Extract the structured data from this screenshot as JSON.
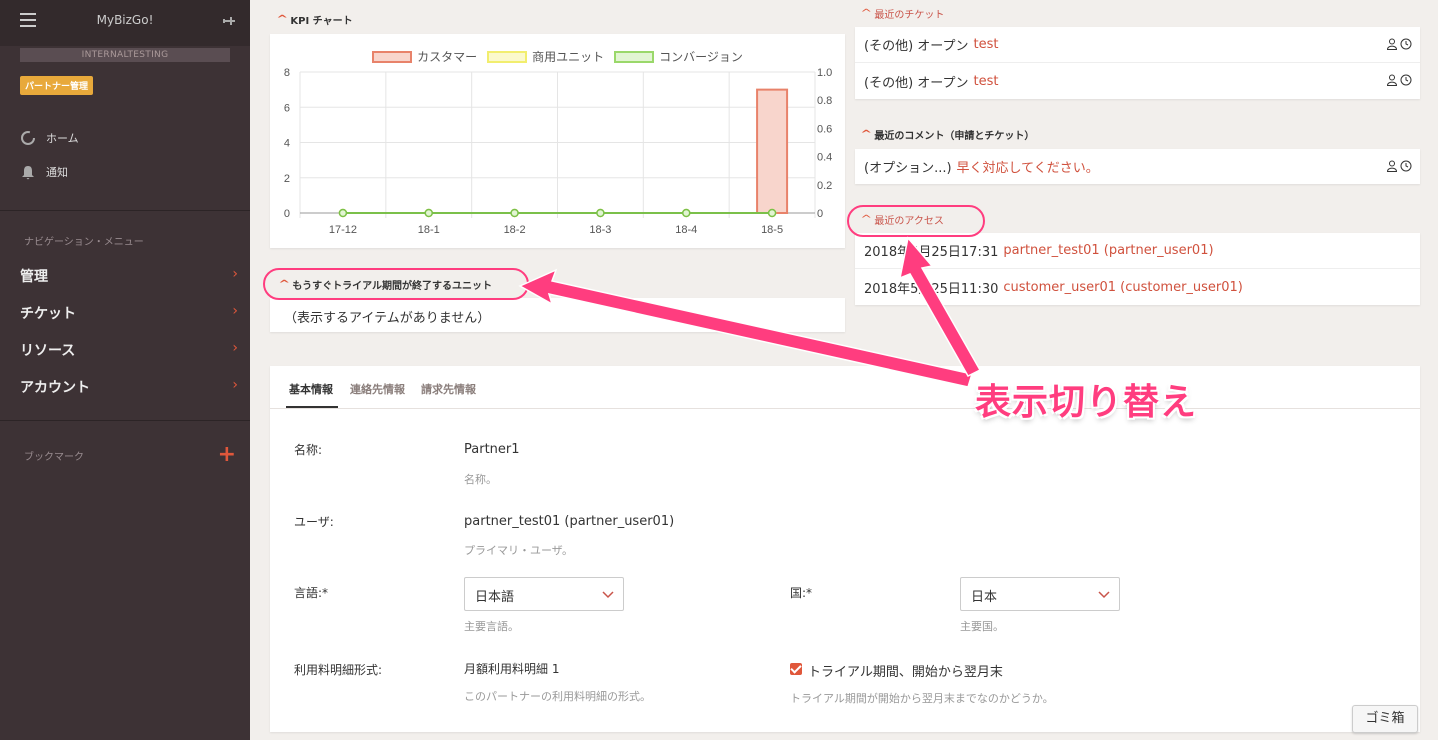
{
  "sidebar": {
    "app_title": "MyBizGo!",
    "environment": "INTERNALTESTING",
    "partner_badge": "パートナー管理",
    "home": "ホーム",
    "notifications": "通知",
    "nav_section": "ナビゲーション・メニュー",
    "menu": [
      "管理",
      "チケット",
      "リソース",
      "アカウント"
    ],
    "bookmarks": "ブックマーク"
  },
  "kpi": {
    "title": "KPI チャート"
  },
  "chart_data": {
    "type": "bar",
    "categories": [
      "17-12",
      "18-1",
      "18-2",
      "18-3",
      "18-4",
      "18-5"
    ],
    "series": [
      {
        "name": "カスタマー",
        "type": "bar",
        "axis": "left",
        "values": [
          0,
          0,
          0,
          0,
          0,
          7
        ],
        "color": "#e8826a"
      },
      {
        "name": "商用ユニット",
        "type": "line",
        "axis": "right",
        "values": [
          0,
          0,
          0,
          0,
          0,
          0
        ],
        "color": "#f2ee6e"
      },
      {
        "name": "コンバージョン",
        "type": "line",
        "axis": "right",
        "values": [
          0,
          0,
          0,
          0,
          0,
          0
        ],
        "color": "#9ad86a"
      }
    ],
    "ylim_left": [
      0,
      8
    ],
    "yticks_left": [
      "0",
      "2",
      "4",
      "6",
      "8"
    ],
    "ylim_right": [
      0,
      1.0
    ],
    "yticks_right": [
      "0",
      "0.2",
      "0.4",
      "0.6",
      "0.8",
      "1.0"
    ],
    "grid": true,
    "legend": "top"
  },
  "expiring": {
    "title": "もうすぐトライアル期間が終了するユニット",
    "empty": "（表示するアイテムがありません）"
  },
  "tickets": {
    "title": "最近のチケット",
    "rows": [
      {
        "prefix": "(その他) オープン",
        "link": "test"
      },
      {
        "prefix": "(その他) オープン",
        "link": "test"
      }
    ]
  },
  "comments": {
    "title": "最近のコメント（申請とチケット）",
    "rows": [
      {
        "prefix": "(オプション...)",
        "link": "早く対応してください。"
      }
    ]
  },
  "access": {
    "title": "最近のアクセス",
    "rows": [
      {
        "prefix": "2018年5月25日17:31",
        "link": "partner_test01 (partner_user01)"
      },
      {
        "prefix": "2018年5月25日11:30",
        "link": "customer_user01 (customer_user01)"
      }
    ]
  },
  "form": {
    "tabs": [
      "基本情報",
      "連絡先情報",
      "請求先情報"
    ],
    "name_label": "名称:",
    "name_value": "Partner1",
    "name_help": "名称。",
    "user_label": "ユーザ:",
    "user_value": "partner_test01 (partner_user01)",
    "user_help": "プライマリ・ユーザ。",
    "lang_label": "言語:*",
    "lang_value": "日本語",
    "lang_help": "主要言語。",
    "country_label": "国:*",
    "country_value": "日本",
    "country_help": "主要国。",
    "billing_label": "利用料明細形式:",
    "billing_value": "月額利用料明細 1",
    "billing_help": "このパートナーの利用料明細の形式。",
    "trial_label": "トライアル期間、開始から翌月末",
    "trial_help": "トライアル期間が開始から翌月末までなのかどうか。"
  },
  "annotation": {
    "callout": "表示切り替え",
    "color": "#ff3d7f"
  },
  "trash": "ゴミ箱"
}
